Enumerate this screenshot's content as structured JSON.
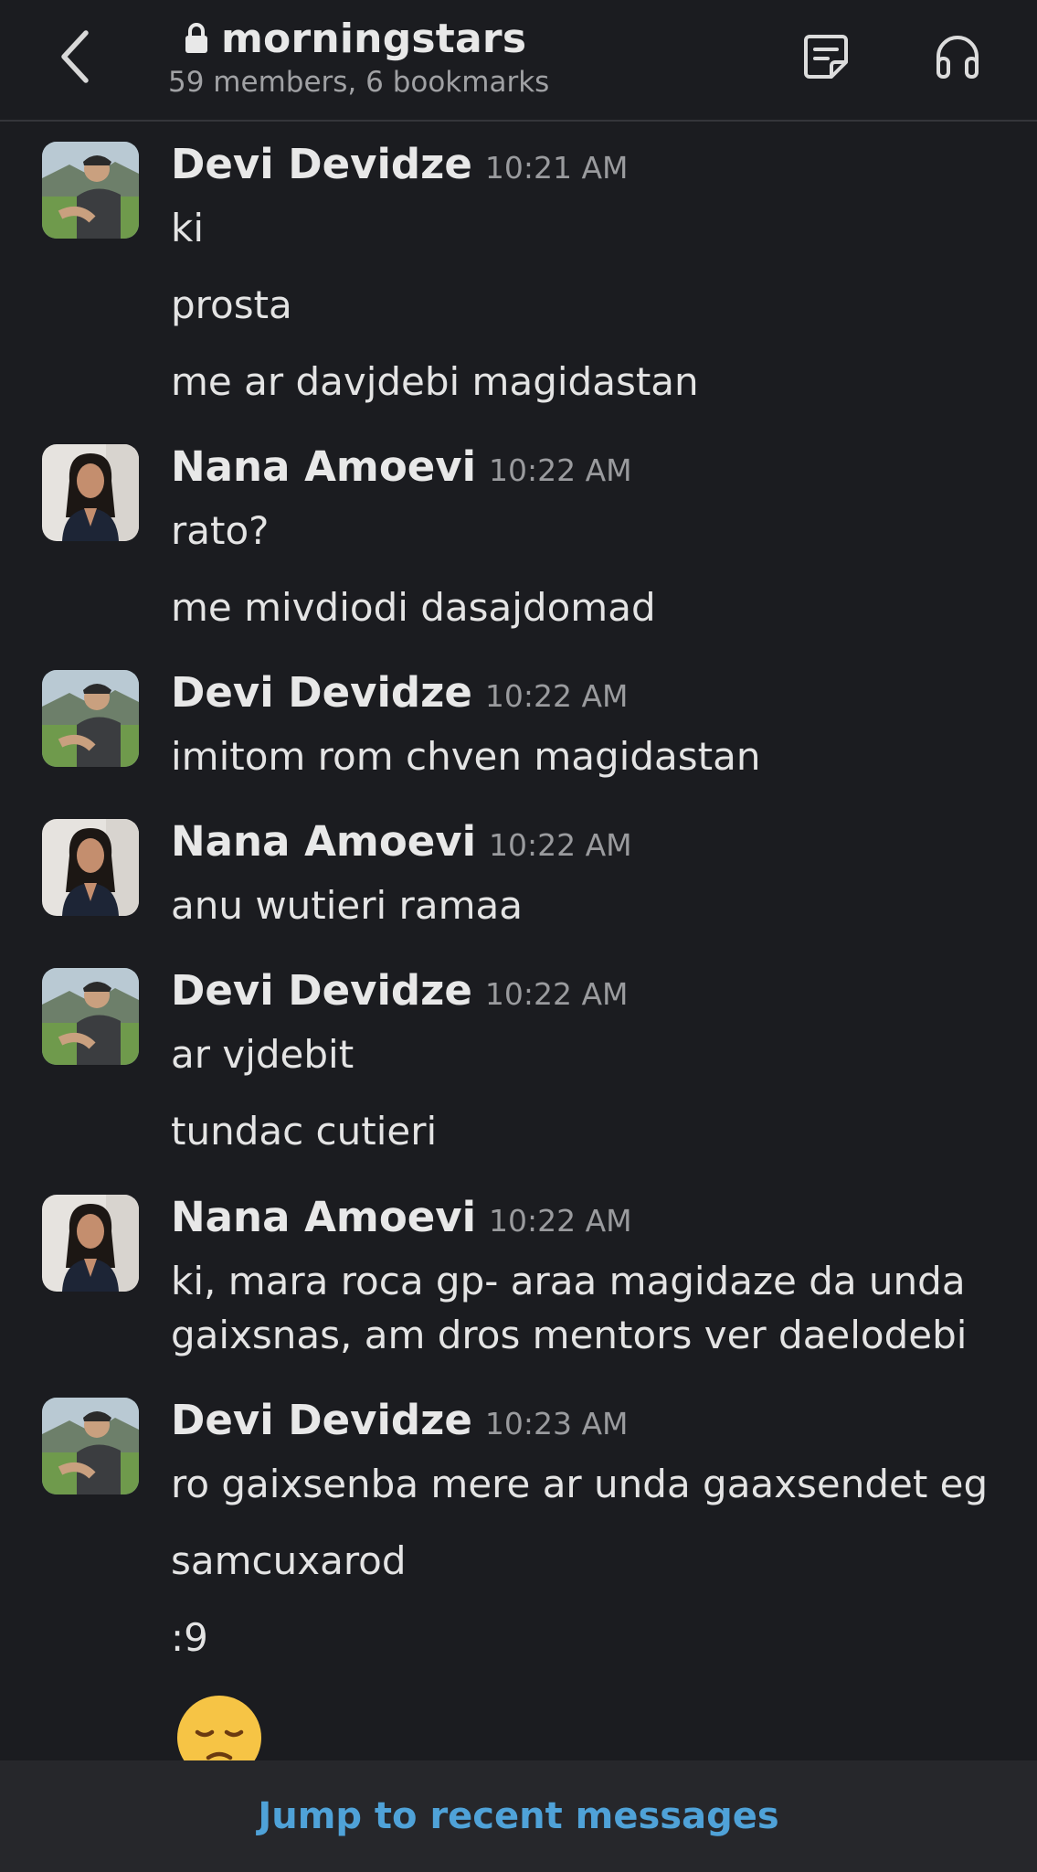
{
  "header": {
    "channel_name": "morningstars",
    "subtitle": "59 members, 6 bookmarks",
    "icons": [
      "back-chevron-icon",
      "lock-icon",
      "canvas-icon",
      "headphones-icon"
    ]
  },
  "messages": [
    {
      "author": "Devi Devidze",
      "time": "10:21 AM",
      "lines": [
        "ki",
        "prosta",
        "me ar davjdebi magidastan"
      ]
    },
    {
      "author": "Nana Amoevi",
      "time": "10:22 AM",
      "lines": [
        "rato?",
        "me mivdiodi dasajdomad"
      ]
    },
    {
      "author": "Devi Devidze",
      "time": "10:22 AM",
      "lines": [
        "imitom rom chven magidastan"
      ]
    },
    {
      "author": "Nana Amoevi",
      "time": "10:22 AM",
      "lines": [
        "anu wutieri ramaa"
      ]
    },
    {
      "author": "Devi Devidze",
      "time": "10:22 AM",
      "lines": [
        "ar vjdebit",
        "tundac cutieri"
      ]
    },
    {
      "author": "Nana Amoevi",
      "time": "10:22 AM",
      "lines": [
        "ki, mara roca gp- araa magidaze da unda",
        "gaixsnas, am dros mentors ver daelodebi"
      ]
    },
    {
      "author": "Devi Devidze",
      "time": "10:23 AM",
      "lines": [
        "ro gaixsenba mere ar unda gaaxsendet eg",
        "samcuxarod",
        ":9"
      ]
    }
  ],
  "footer": {
    "jump_label": "Jump to recent messages"
  },
  "colors": {
    "background": "#1b1c20",
    "link": "#4fa2d8",
    "muted": "#9a9b9e"
  }
}
